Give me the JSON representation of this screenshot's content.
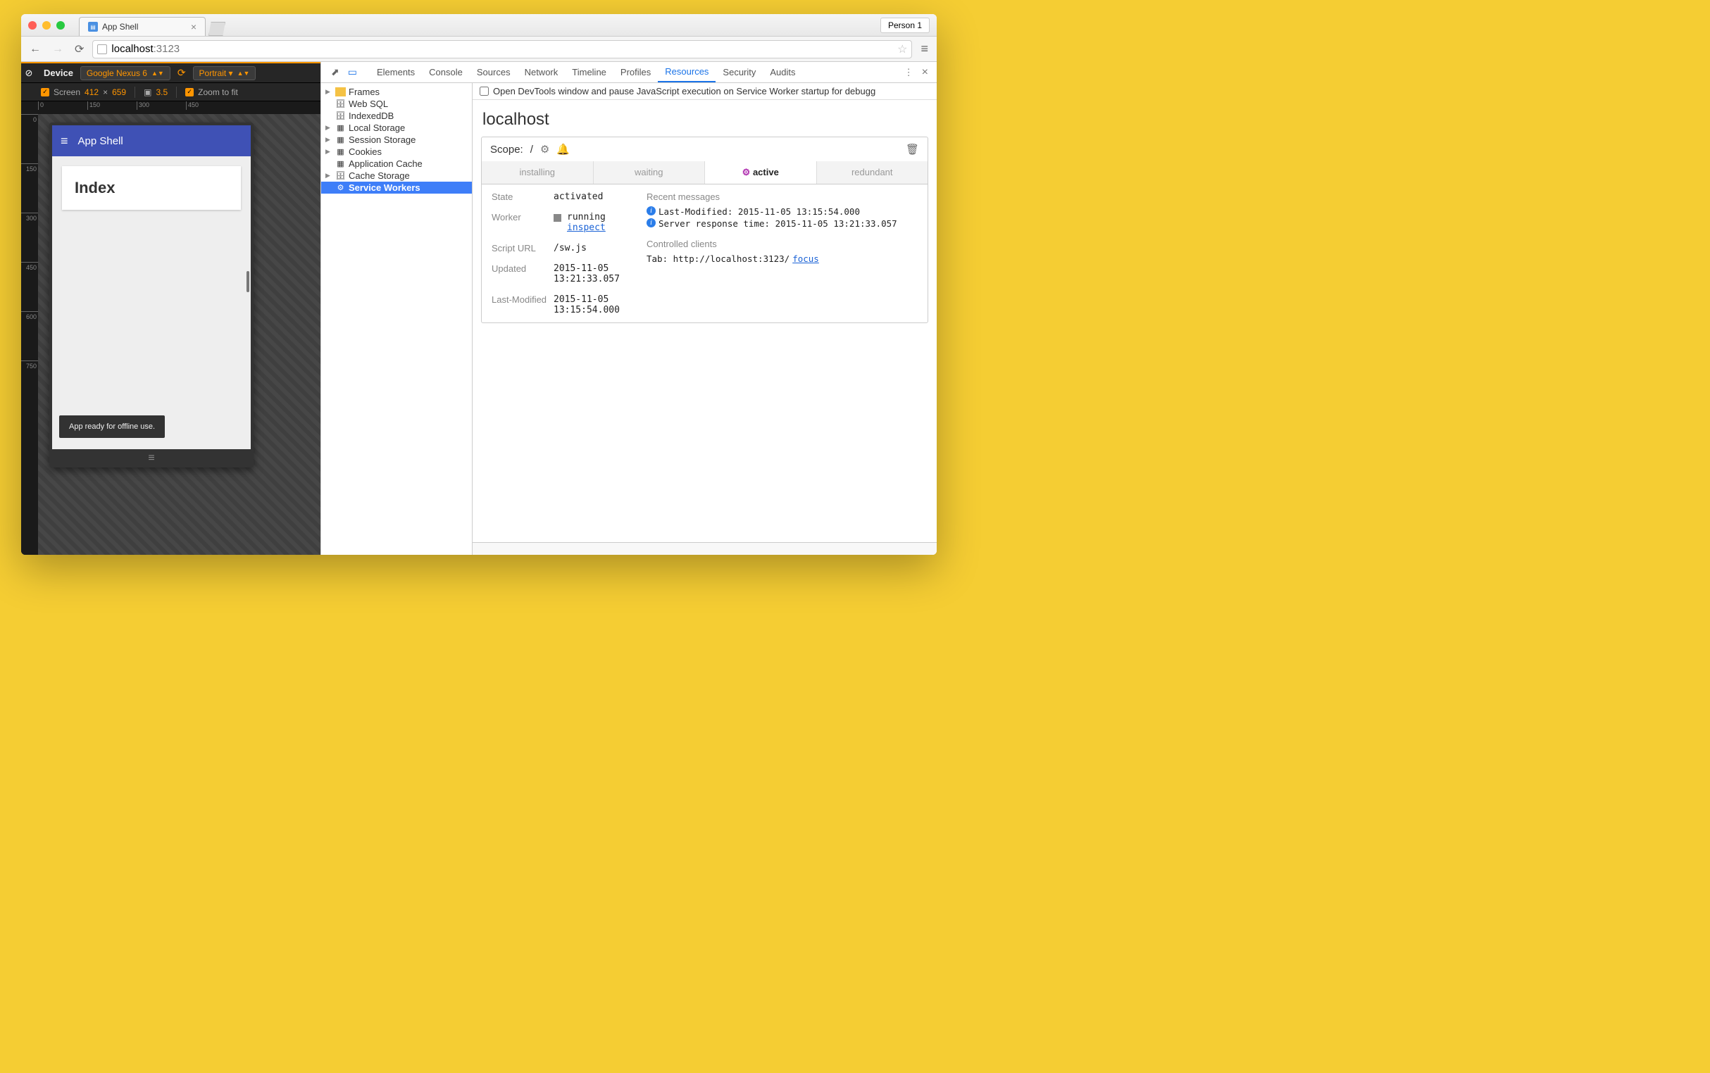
{
  "browser": {
    "tab_title": "App Shell",
    "person_label": "Person 1",
    "url_host": "localhost",
    "url_port": ":3123"
  },
  "device_bar": {
    "device_label": "Device",
    "device_value": "Google Nexus 6",
    "orientation": "Portrait ▾",
    "screen_label": "Screen",
    "width": "412",
    "times": "×",
    "height": "659",
    "dpr": "3.5",
    "zoom_label": "Zoom to fit"
  },
  "ruler": {
    "h": [
      "0",
      "150",
      "300",
      "450"
    ],
    "v": [
      "0",
      "150",
      "300",
      "450",
      "600",
      "750"
    ]
  },
  "app": {
    "title": "App Shell",
    "card": "Index",
    "toast": "App ready for offline use."
  },
  "devtools": {
    "tabs": [
      "Elements",
      "Console",
      "Sources",
      "Network",
      "Timeline",
      "Profiles",
      "Resources",
      "Security",
      "Audits"
    ],
    "active_tab": "Resources",
    "resources": [
      "Frames",
      "Web SQL",
      "IndexedDB",
      "Local Storage",
      "Session Storage",
      "Cookies",
      "Application Cache",
      "Cache Storage",
      "Service Workers"
    ],
    "selected": "Service Workers",
    "option_text": "Open DevTools window and pause JavaScript execution on Service Worker startup for debugg",
    "host": "localhost",
    "scope_label": "Scope:",
    "scope_value": "/",
    "sw_tabs": [
      "installing",
      "waiting",
      "active",
      "redundant"
    ],
    "sw_active": "active",
    "fields": {
      "state_label": "State",
      "state": "activated",
      "worker_label": "Worker",
      "worker_status": "running",
      "worker_inspect": "inspect",
      "script_label": "Script URL",
      "script": "/sw.js",
      "updated_label": "Updated",
      "updated": "2015-11-05 13:21:33.057",
      "lastmod_label": "Last-Modified",
      "lastmod": "2015-11-05 13:15:54.000"
    },
    "messages": {
      "header": "Recent messages",
      "m1": "Last-Modified: 2015-11-05 13:15:54.000",
      "m2": "Server response time: 2015-11-05 13:21:33.057",
      "clients_header": "Controlled clients",
      "client_prefix": "Tab: http://localhost:3123/ ",
      "focus": "focus"
    }
  }
}
